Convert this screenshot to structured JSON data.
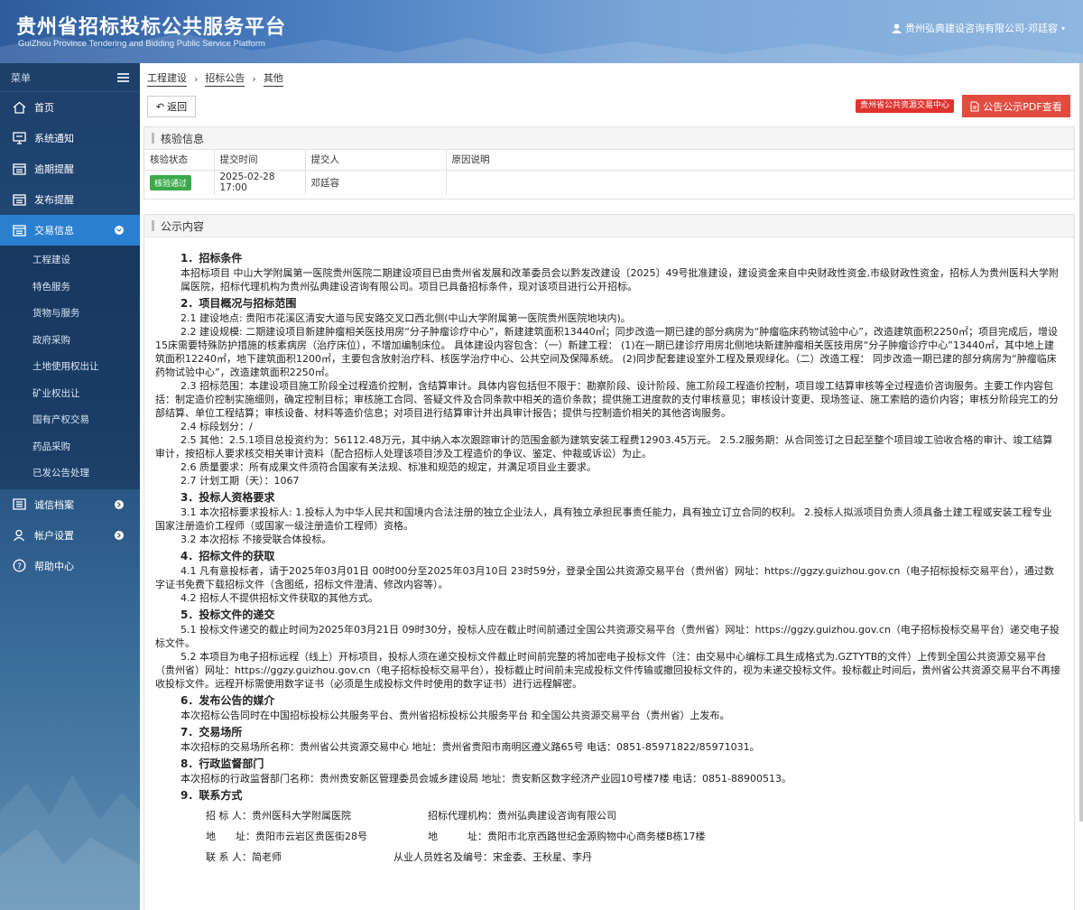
{
  "header": {
    "title": "贵州省招标投标公共服务平台",
    "subtitle": "GuiZhou Province Tendering and Bidding Public Service Platform",
    "user": "贵州弘典建设咨询有限公司-邓廷容"
  },
  "sidebar": {
    "menu_label": "菜单",
    "items": [
      {
        "label": "首页",
        "icon": "home-icon"
      },
      {
        "label": "系统通知",
        "icon": "monitor-icon"
      },
      {
        "label": "逾期提醒",
        "icon": "list-icon"
      },
      {
        "label": "发布提醒",
        "icon": "list-icon"
      },
      {
        "label": "交易信息",
        "icon": "list-icon"
      },
      {
        "label": "诚信档案",
        "icon": "archive-icon"
      },
      {
        "label": "帐户设置",
        "icon": "user-icon"
      },
      {
        "label": "帮助中心",
        "icon": "help-icon"
      }
    ],
    "sub_items": [
      "工程建设",
      "特色服务",
      "货物与服务",
      "政府采购",
      "土地使用权出让",
      "矿业权出让",
      "国有产权交易",
      "药品采购",
      "已发公告处理"
    ]
  },
  "breadcrumb": [
    "工程建设",
    "招标公告",
    "其他"
  ],
  "toolbar": {
    "back_label": "返回",
    "tag": "贵州省公共资源交易中心",
    "pdf_label": "公告公示PDF查看"
  },
  "verify": {
    "title": "核验信息",
    "headers": [
      "核验状态",
      "提交时间",
      "提交人",
      "原因说明"
    ],
    "row": {
      "status": "核验通过",
      "time": "2025-02-28 17:00",
      "person": "邓廷容",
      "reason": ""
    }
  },
  "content": {
    "title": "公示内容",
    "s1_h": "1．招标条件",
    "s1_p": "本招标项目 中山大学附属第一医院贵州医院二期建设项目已由贵州省发展和改革委员会以黔发改建设〔2025〕49号批准建设，建设资金来自中央财政性资金,市级财政性资金，招标人为贵州医科大学附属医院，招标代理机构为贵州弘典建设咨询有限公司。项目已具备招标条件，现对该项目进行公开招标。",
    "s2_h": "2．项目概况与招标范围",
    "s2_1": "2.1 建设地点: 贵阳市花溪区清安大道与民安路交叉口西北侧(中山大学附属第一医院贵州医院地块内)。",
    "s2_2": "2.2 建设规模: 二期建设项目新建肿瘤相关医技用房“分子肿瘤诊疗中心”，新建建筑面积13440㎡；同步改造一期已建的部分病房为“肿瘤临床药物试验中心”，改造建筑面积2250㎡；项目完成后，增设15床需要特殊防护措施的核素病房（治疗床位），不增加编制床位。 具体建设内容包含：（一）新建工程： (1)在一期已建诊疗用房北侧地块新建肿瘤相关医技用房“分子肿瘤诊疗中心”13440㎡，其中地上建筑面积12240㎡，地下建筑面积1200㎡，主要包含放射治疗科、核医学治疗中心、公共空间及保障系统。 (2)同步配套建设室外工程及景观绿化。（二）改造工程： 同步改造一期已建的部分病房为“肿瘤临床药物试验中心”，改造建筑面积2250㎡。",
    "s2_3": "2.3 招标范围：本建设项目施工阶段全过程造价控制，含结算审计。具体内容包括但不限于：勘察阶段、设计阶段、施工阶段工程造价控制，项目竣工结算审核等全过程造价咨询服务。主要工作内容包括：制定造价控制实施细则，确定控制目标；审核施工合同、答疑文件及合同条款中相关的造价条款；提供施工进度款的支付审核意见；审核设计变更、现场签证、施工索赔的造价内容；审核分阶段完工的分部结算、单位工程结算；审核设备、材料等造价信息；对项目进行结算审计并出具审计报告；提供与控制造价相关的其他咨询服务。",
    "s2_4": "2.4 标段划分：/",
    "s2_5": "2.5 其他：2.5.1项目总投资约为：56112.48万元，其中纳入本次跟踪审计的范围金额为建筑安装工程费12903.45万元。 2.5.2服务期：从合同签订之日起至整个项目竣工验收合格的审计、竣工结算审计，按招标人要求核交相关审计资料（配合招标人处理该项目涉及工程造价的争议、鉴定、仲裁或诉讼）为止。",
    "s2_6": "2.6 质量要求：所有成果文件须符合国家有关法规、标准和规范的规定，并满足项目业主要求。",
    "s2_7": "2.7 计划工期（天）：1067",
    "s3_h": "3．投标人资格要求",
    "s3_1": "3.1 本次招标要求投标人: 1.投标人为中华人民共和国境内合法注册的独立企业法人，具有独立承担民事责任能力，具有独立订立合同的权利。 2.投标人拟派项目负责人须具备土建工程或安装工程专业国家注册造价工程师（或国家一级注册造价工程师）资格。",
    "s3_2": "3.2 本次招标 不接受联合体投标。",
    "s4_h": "4．招标文件的获取",
    "s4_1": "4.1 凡有意投标者，请于2025年03月01日 00时00分至2025年03月10日 23时59分，登录全国公共资源交易平台（贵州省）网址：https://ggzy.guizhou.gov.cn（电子招标投标交易平台），通过数字证书免费下载招标文件（含图纸，招标文件澄清、修改内容等）。",
    "s4_2": "4.2 招标人不提供招标文件获取的其他方式。",
    "s5_h": "5．投标文件的递交",
    "s5_1": "5.1 投标文件递交的截止时间为2025年03月21日 09时30分，投标人应在截止时间前通过全国公共资源交易平台（贵州省）网址：https://ggzy.guizhou.gov.cn（电子招标投标交易平台）递交电子投标文件。",
    "s5_2": "5.2 本项目为电子招标远程（线上）开标项目，投标人须在递交投标文件截止时间前完整的将加密电子投标文件（注：由交易中心编标工具生成格式为.GZTYTB的文件）上传到全国公共资源交易平台（贵州省）网址：https://ggzy.guizhou.gov.cn（电子招标投标交易平台），投标截止时间前未完成投标文件传输或撤回投标文件的，视为未递交投标文件。投标截止时间后，贵州省公共资源交易平台不再接收投标文件。远程开标需使用数字证书（必须是生成投标文件时使用的数字证书）进行远程解密。",
    "s6_h": "6．发布公告的媒介",
    "s6_p": "本次招标公告同时在中国招标投标公共服务平台、贵州省招标投标公共服务平台 和全国公共资源交易平台（贵州省）上发布。",
    "s7_h": "7．交易场所",
    "s7_p": "本次招标的交易场所名称：贵州省公共资源交易中心 地址：贵州省贵阳市南明区遵义路65号 电话：0851-85971822/85971031。",
    "s8_h": "8．行政监督部门",
    "s8_p": "本次招标的行政监督部门名称：贵州贵安新区管理委员会城乡建设局 地址：贵安新区数字经济产业园10号楼7楼 电话：0851-88900513。",
    "s9_h": "9．联系方式",
    "contact": [
      [
        "招 标 人：贵州医科大学附属医院",
        "招标代理机构：贵州弘典建设咨询有限公司"
      ],
      [
        "地　　址：贵阳市云岩区贵医街28号",
        "地　　　址：贵阳市北京西路世纪金源购物中心商务楼B栋17楼"
      ],
      [
        "联 系 人：简老师",
        "从业人员姓名及编号：宋金委、王秋星、李丹"
      ]
    ]
  }
}
